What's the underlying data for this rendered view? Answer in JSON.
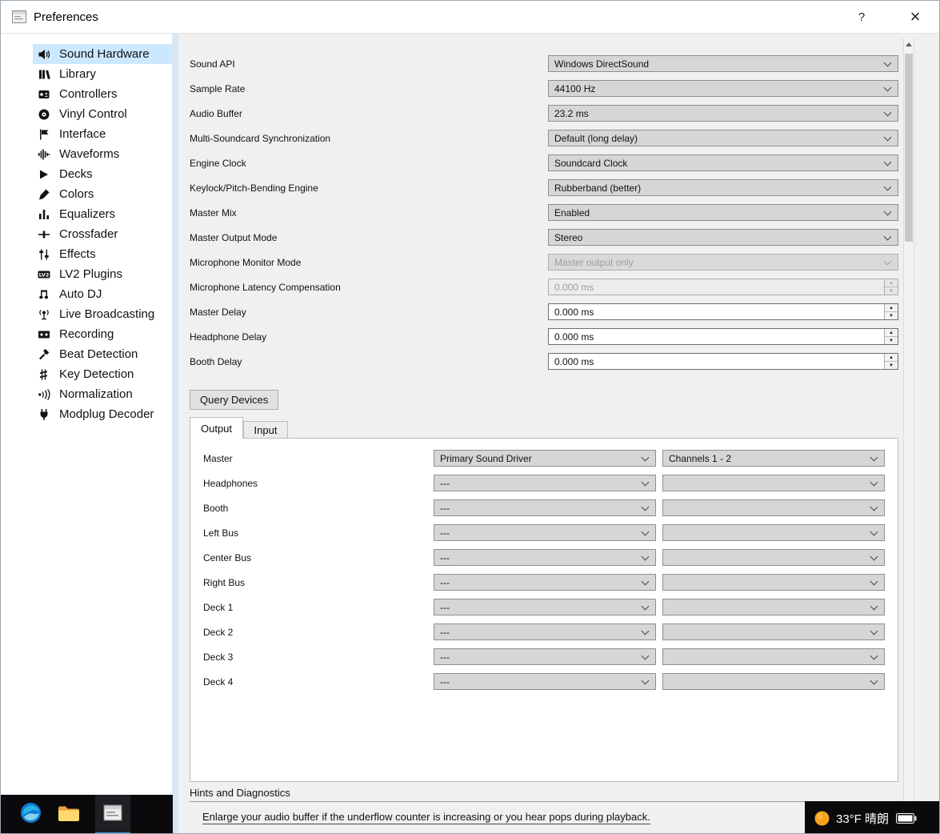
{
  "window": {
    "title": "Preferences",
    "help_label": "?",
    "close_label": "×"
  },
  "sidebar": {
    "items": [
      {
        "label": "Sound Hardware",
        "icon": "speaker-icon",
        "selected": true
      },
      {
        "label": "Library",
        "icon": "library-icon",
        "selected": false
      },
      {
        "label": "Controllers",
        "icon": "controller-icon",
        "selected": false
      },
      {
        "label": "Vinyl Control",
        "icon": "vinyl-icon",
        "selected": false
      },
      {
        "label": "Interface",
        "icon": "flag-icon",
        "selected": false
      },
      {
        "label": "Waveforms",
        "icon": "waveform-icon",
        "selected": false
      },
      {
        "label": "Decks",
        "icon": "play-icon",
        "selected": false
      },
      {
        "label": "Colors",
        "icon": "brush-icon",
        "selected": false
      },
      {
        "label": "Equalizers",
        "icon": "equalizer-icon",
        "selected": false
      },
      {
        "label": "Crossfader",
        "icon": "crossfader-icon",
        "selected": false
      },
      {
        "label": "Effects",
        "icon": "sliders-icon",
        "selected": false
      },
      {
        "label": "LV2 Plugins",
        "icon": "lv2-icon",
        "selected": false
      },
      {
        "label": "Auto DJ",
        "icon": "music-notes-icon",
        "selected": false
      },
      {
        "label": "Live Broadcasting",
        "icon": "broadcast-icon",
        "selected": false
      },
      {
        "label": "Recording",
        "icon": "recording-icon",
        "selected": false
      },
      {
        "label": "Beat Detection",
        "icon": "hammer-icon",
        "selected": false
      },
      {
        "label": "Key Detection",
        "icon": "key-signature-icon",
        "selected": false
      },
      {
        "label": "Normalization",
        "icon": "sound-waves-icon",
        "selected": false
      },
      {
        "label": "Modplug Decoder",
        "icon": "plug-icon",
        "selected": false
      }
    ]
  },
  "form": {
    "rows": [
      {
        "label": "Sound API",
        "value": "Windows DirectSound",
        "control": "select",
        "disabled": false
      },
      {
        "label": "Sample Rate",
        "value": "44100 Hz",
        "control": "select",
        "disabled": false
      },
      {
        "label": "Audio Buffer",
        "value": "23.2 ms",
        "control": "select",
        "disabled": false
      },
      {
        "label": "Multi-Soundcard Synchronization",
        "value": "Default (long delay)",
        "control": "select",
        "disabled": false
      },
      {
        "label": "Engine Clock",
        "value": "Soundcard Clock",
        "control": "select",
        "disabled": false
      },
      {
        "label": "Keylock/Pitch-Bending Engine",
        "value": "Rubberband (better)",
        "control": "select",
        "disabled": false
      },
      {
        "label": "Master Mix",
        "value": "Enabled",
        "control": "select",
        "disabled": false
      },
      {
        "label": "Master Output Mode",
        "value": "Stereo",
        "control": "select",
        "disabled": false
      },
      {
        "label": "Microphone Monitor Mode",
        "value": "Master output only",
        "control": "select",
        "disabled": true
      },
      {
        "label": "Microphone Latency Compensation",
        "value": "0.000 ms",
        "control": "spinbox",
        "disabled": true
      },
      {
        "label": "Master Delay",
        "value": "0.000 ms",
        "control": "spinbox",
        "disabled": false
      },
      {
        "label": "Headphone Delay",
        "value": "0.000 ms",
        "control": "spinbox",
        "disabled": false
      },
      {
        "label": "Booth Delay",
        "value": "0.000 ms",
        "control": "spinbox",
        "disabled": false
      }
    ],
    "query_devices_label": "Query Devices"
  },
  "tabs": {
    "output": "Output",
    "input": "Input",
    "active": "Output"
  },
  "routing": {
    "rows": [
      {
        "label": "Master",
        "device": "Primary Sound Driver",
        "channels": "Channels 1 - 2"
      },
      {
        "label": "Headphones",
        "device": "---",
        "channels": ""
      },
      {
        "label": "Booth",
        "device": "---",
        "channels": ""
      },
      {
        "label": "Left Bus",
        "device": "---",
        "channels": ""
      },
      {
        "label": "Center Bus",
        "device": "---",
        "channels": ""
      },
      {
        "label": "Right Bus",
        "device": "---",
        "channels": ""
      },
      {
        "label": "Deck 1",
        "device": "---",
        "channels": ""
      },
      {
        "label": "Deck 2",
        "device": "---",
        "channels": ""
      },
      {
        "label": "Deck 3",
        "device": "---",
        "channels": ""
      },
      {
        "label": "Deck 4",
        "device": "---",
        "channels": ""
      }
    ]
  },
  "hints": {
    "title": "Hints and Diagnostics",
    "text": "Enlarge your audio buffer if the underflow counter is increasing or you hear pops during playback."
  },
  "taskbar": {
    "weather": "33°F 晴朗"
  }
}
